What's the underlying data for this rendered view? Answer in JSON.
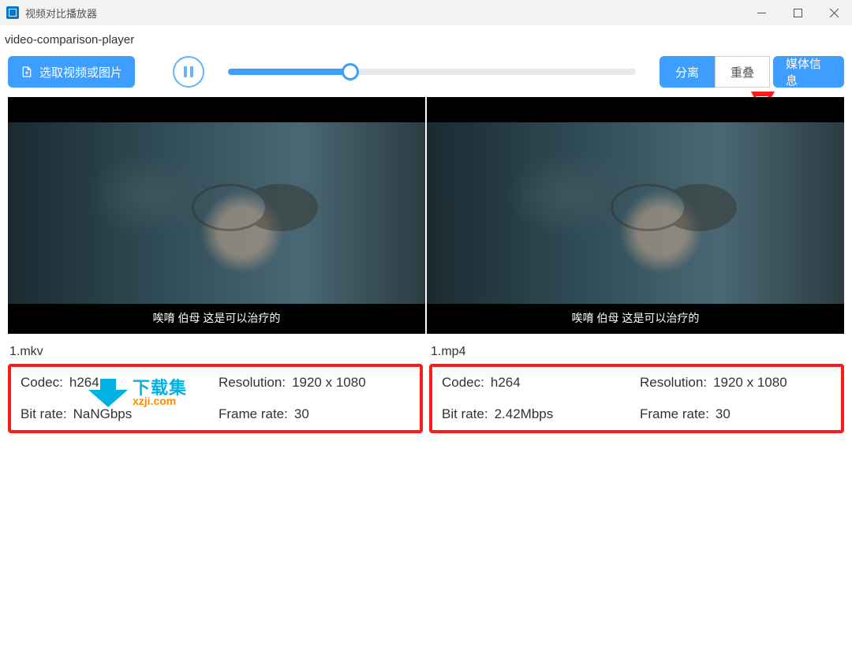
{
  "window": {
    "title": "视频对比播放器"
  },
  "header": {
    "subtitle": "video-comparison-player"
  },
  "toolbar": {
    "select_label": "选取视频或图片",
    "segmented": {
      "separate": "分离",
      "overlap": "重叠",
      "media_info": "媒体信息"
    }
  },
  "player": {
    "progress_percent": 30,
    "state": "paused"
  },
  "panes": [
    {
      "filename": "1.mkv",
      "subtitle": "唉唷 伯母 这是可以治疗的",
      "info": {
        "codec_label": "Codec:",
        "codec": "h264",
        "resolution_label": "Resolution:",
        "resolution": "1920 x 1080",
        "bitrate_label": "Bit rate:",
        "bitrate": "NaNGbps",
        "framerate_label": "Frame rate:",
        "framerate": "30"
      }
    },
    {
      "filename": "1.mp4",
      "subtitle": "唉唷 伯母 这是可以治疗的",
      "info": {
        "codec_label": "Codec:",
        "codec": "h264",
        "resolution_label": "Resolution:",
        "resolution": "1920 x 1080",
        "bitrate_label": "Bit rate:",
        "bitrate": "2.42Mbps",
        "framerate_label": "Frame rate:",
        "framerate": "30"
      }
    }
  ],
  "watermark": {
    "top": "下载集",
    "bottom": "xzji.com"
  }
}
